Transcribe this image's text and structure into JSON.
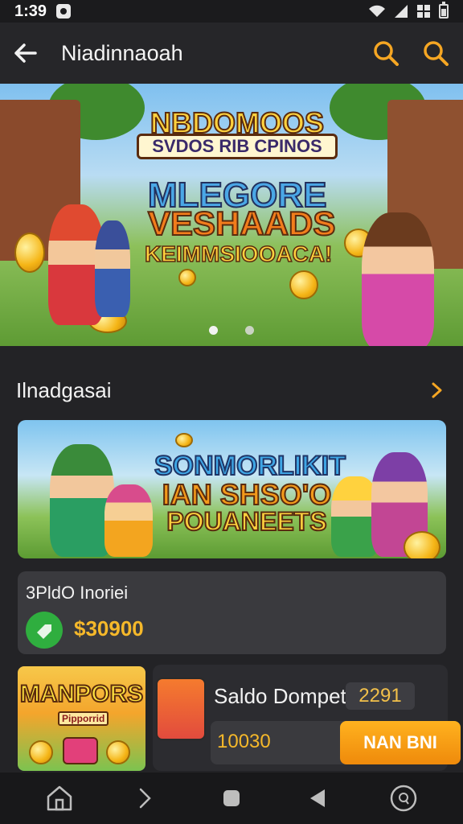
{
  "status_bar": {
    "time": "1:39"
  },
  "app_bar": {
    "title": "Niadinnaoah"
  },
  "banner": {
    "title_top": "NBDOMOOS",
    "title_sub": "SVDOS RIB CPINOS",
    "line1": "MLEGORE",
    "line2": "VESHAADS",
    "line3": "KEIMMSIOOACA!"
  },
  "section": {
    "title": "Ilnadgasai"
  },
  "promo": {
    "line1": "SONMORLIKIT",
    "line2": "IAN SHSO'O",
    "line3": "POUANEETS"
  },
  "balance": {
    "label": "3PldO Inoriei",
    "value": "$30900"
  },
  "game": {
    "title": "MANPORS",
    "subtitle": "Pipporrid"
  },
  "wallet": {
    "title": "Saldo Dompet",
    "badge": "2291",
    "amount": "10030",
    "cta_label": "NAN BNI"
  },
  "colors": {
    "accent": "#f5b82a",
    "cta": "#ffb21f",
    "background": "#232326"
  }
}
